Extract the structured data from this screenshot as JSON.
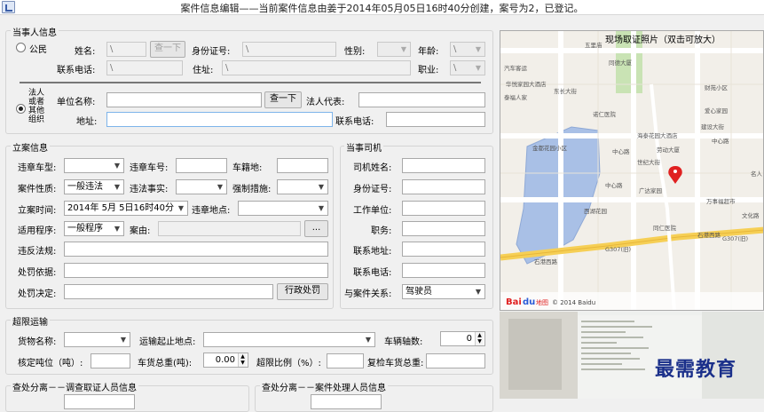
{
  "window": {
    "title": "案件信息编辑——当前案件信息由姜于2014年05月05日16时40分创建，案号为2，已登记。"
  },
  "party": {
    "group_title": "当事人信息",
    "citizen": {
      "radio_label": "公民",
      "name_label": "姓名:",
      "name_value": "\\",
      "lookup_button": "查一下",
      "id_label": "身份证号:",
      "id_value": "\\",
      "gender_label": "性别:",
      "age_label": "年龄:",
      "age_value": "\\",
      "phone_label": "联系电话:",
      "phone_value": "\\",
      "address_label": "住址:",
      "address_value": "\\",
      "job_label": "职业:",
      "job_value": "\\"
    },
    "org": {
      "radio_label_lines": [
        "法人",
        "或者",
        "其他",
        "组织"
      ],
      "unit_label": "单位名称:",
      "unit_value": "",
      "lookup_button": "查一下",
      "rep_label": "法人代表:",
      "rep_value": "",
      "address_label": "地址:",
      "address_value": "",
      "phone_label": "联系电话:",
      "phone_value": ""
    }
  },
  "case": {
    "group_title": "立案信息",
    "vehicle_type_label": "违章车型:",
    "vehicle_type_value": "",
    "plate_label": "违章车号:",
    "plate_value": "",
    "origin_label": "车籍地:",
    "origin_value": "",
    "nature_label": "案件性质:",
    "nature_value": "一般违法",
    "fact_label": "违法事实:",
    "fact_value": "",
    "measure_label": "强制措施:",
    "measure_value": "",
    "time_label": "立案时间:",
    "time_value": "2014年 5月 5日16时40分",
    "place_label": "违章地点:",
    "place_value": "",
    "procedure_label": "适用程序:",
    "procedure_value": "一般程序",
    "cause_label": "案由:",
    "cause_value": "",
    "cause_button": "...",
    "law_label": "违反法规:",
    "law_value": "",
    "basis_label": "处罚依据:",
    "basis_value": "",
    "decision_label": "处罚决定:",
    "decision_value": "",
    "decision_button": "行政处罚"
  },
  "driver": {
    "group_title": "当事司机",
    "name_label": "司机姓名:",
    "name_value": "",
    "id_label": "身份证号:",
    "id_value": "",
    "work_label": "工作单位:",
    "work_value": "",
    "post_label": "职务:",
    "post_value": "",
    "address_label": "联系地址:",
    "address_value": "",
    "phone_label": "联系电话:",
    "phone_value": "",
    "relation_label": "与案件关系:",
    "relation_value": "驾驶员"
  },
  "overload": {
    "group_title": "超限运输",
    "cargo_label": "货物名称:",
    "cargo_value": "",
    "route_label": "运输起止地点:",
    "route_value": "",
    "axle_label": "车辆轴数:",
    "axle_value": "0",
    "rated_label": "核定吨位（吨）:",
    "rated_value": "",
    "total_label": "车货总重(吨):",
    "total_value": "0.00",
    "ratio_label": "超限比例（%）:",
    "ratio_value": "",
    "recheck_label": "复检车货总重:",
    "recheck_value": ""
  },
  "separation": {
    "left_title": "查处分离－－调查取证人员信息",
    "right_title": "查处分离－－案件处理人员信息"
  },
  "map": {
    "title": "现场取证照片（双击可放大）",
    "labels": [
      "汽车客运",
      "五里庙",
      "同德大厦",
      "华悦家园大酒店",
      "泰福人家",
      "诺仁医院",
      "海泰花园大酒店",
      "中心路",
      "劳动大厦",
      "财苑小区",
      "爱心家园",
      "中心路",
      "金都花园小区",
      "广达家园",
      "万事福超市",
      "名人",
      "西湖花园",
      "同仁医院",
      "文化路",
      "石港西路",
      "石港西路",
      "G307(旧)",
      "G307(旧)",
      "东长大街",
      "建设大街",
      "世纪大街",
      "中心路"
    ],
    "copyright": "© 2014 Baidu",
    "brand": "Bai",
    "brand_paw": "du",
    "brand_cn": "地图"
  },
  "photo": {
    "watermark": "最需教育"
  },
  "colors": {
    "lake": "#a9c0e6",
    "park": "#c9e3b4",
    "road_major": "#f6cf55",
    "marker": "#e02020",
    "watermark": "#1a2f8a"
  }
}
